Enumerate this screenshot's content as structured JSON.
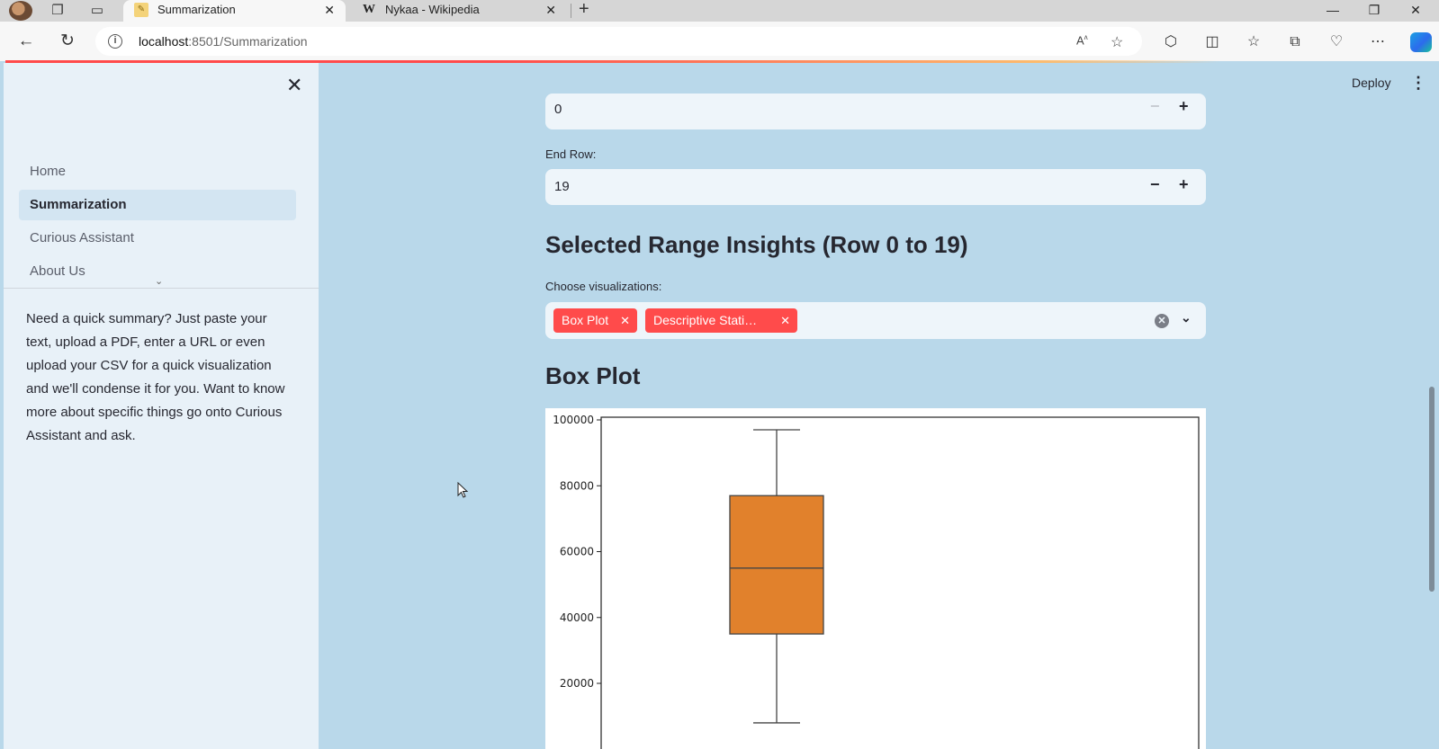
{
  "browser": {
    "tabs": [
      {
        "title": "Summarization",
        "favicon": "notepad-favicon",
        "active": true
      },
      {
        "title": "Nykaa - Wikipedia",
        "favicon": "wikipedia-favicon",
        "active": false
      }
    ],
    "url_host": "localhost",
    "url_path": ":8501/Summarization"
  },
  "sidebar": {
    "nav": [
      {
        "label": "Home",
        "active": false
      },
      {
        "label": "Summarization",
        "active": true
      },
      {
        "label": "Curious Assistant",
        "active": false
      },
      {
        "label": "About Us",
        "active": false
      }
    ],
    "description": "Need a quick summary? Just paste your text, upload a PDF, enter a URL or even upload your CSV for a quick visualization and we'll condense it for you. Want to know more about specific things go onto Curious Assistant and ask."
  },
  "header": {
    "deploy_label": "Deploy"
  },
  "main": {
    "start_row_value": "0",
    "end_row_label": "End Row:",
    "end_row_value": "19",
    "insights_heading": "Selected Range Insights (Row 0 to 19)",
    "viz_label": "Choose visualizations:",
    "viz_chips": [
      "Box Plot",
      "Descriptive Stati…"
    ],
    "boxplot_heading": "Box Plot"
  },
  "colors": {
    "accent": "#ff4b4b",
    "box_fill": "#e1812c",
    "main_bg": "#b9d8ea",
    "sidebar_bg": "#e8f1f8"
  },
  "chart_data": {
    "type": "box",
    "yticks": [
      20000,
      40000,
      60000,
      80000,
      100000
    ],
    "ylim": [
      0,
      104000
    ],
    "series": [
      {
        "whisker_low": 8000,
        "q1": 35000,
        "median": 55000,
        "q3": 77000,
        "whisker_high": 97000
      }
    ]
  }
}
